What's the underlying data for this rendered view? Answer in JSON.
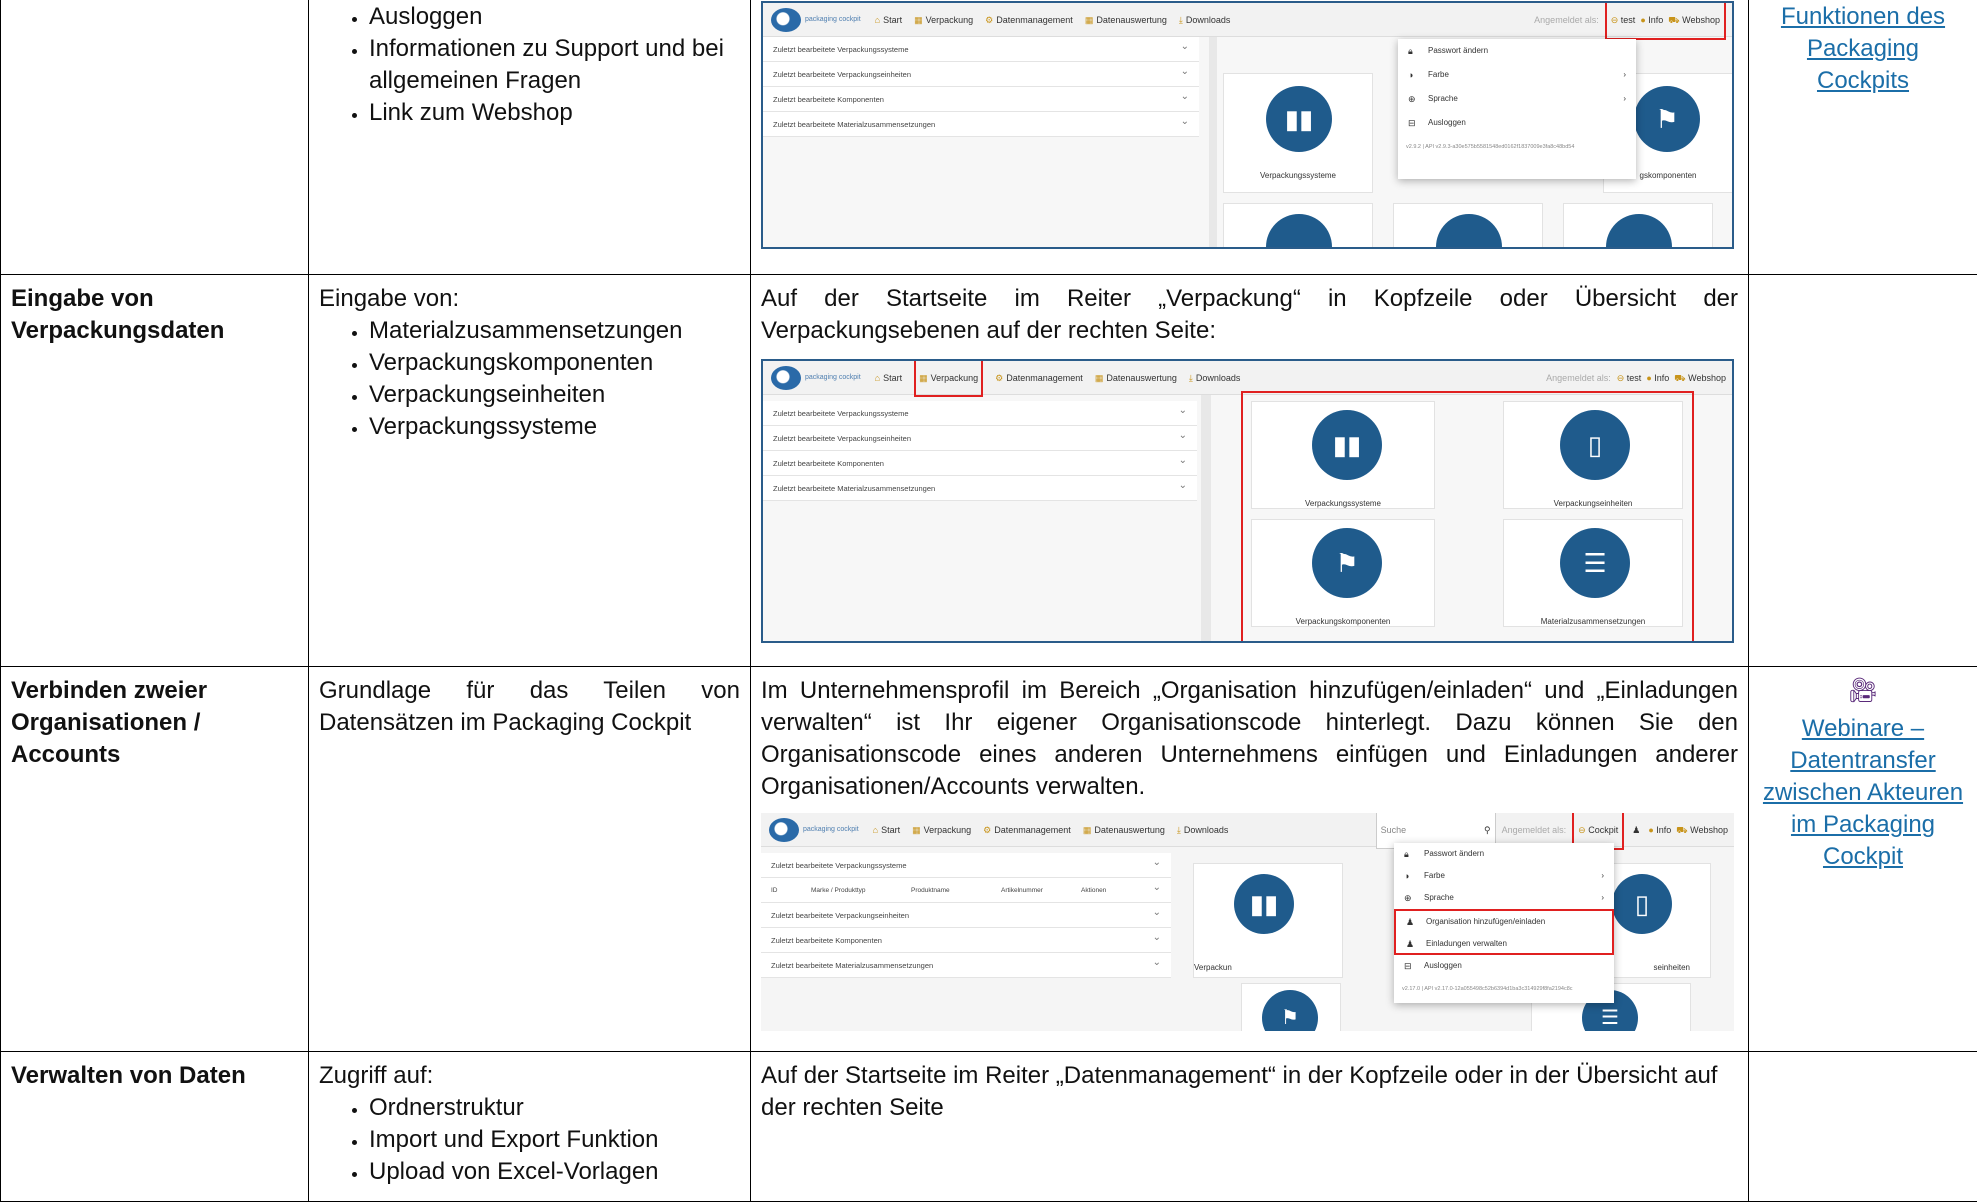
{
  "row1": {
    "bullets": [
      "Ausloggen",
      "Informationen zu Support und bei allgemeinen Fragen",
      "Link zum Webshop"
    ],
    "link": "Funktionen des Packaging Cockpits"
  },
  "row2": {
    "title": "Eingabe von Verpackungsdaten",
    "intro": "Eingabe von:",
    "bullets": [
      "Materialzusammensetzungen",
      "Verpackungskomponenten",
      "Verpackungseinheiten",
      "Verpackungssysteme"
    ],
    "description": "Auf der Startseite im Reiter „Verpackung“ in Kopfzeile oder Übersicht der Verpackungsebenen auf der rechten Seite:"
  },
  "row3": {
    "title": "Verbinden zweier Organisationen / Accounts",
    "desc": "Grundlage für das Teilen von Datensätzen im Packaging Cockpit",
    "description": "Im Unternehmensprofil im Bereich „Organisation hinzufügen/einladen“ und „Einladungen verwalten“ ist Ihr eigener Organisationscode hinterlegt. Dazu können Sie den Organisationscode eines anderen Unternehmens einfügen und Einladungen anderer Organisationen/Accounts verwalten.",
    "link": "Webinare – Datentransfer zwischen Akteuren im Packaging Cockpit"
  },
  "row4": {
    "title": "Verwalten von Daten",
    "intro": "Zugriff auf:",
    "bullets": [
      "Ordnerstruktur",
      "Import und Export Funktion",
      "Upload von Excel-Vorlagen"
    ],
    "description": "Auf der Startseite im Reiter „Datenmanagement“ in der Kopfzeile oder in der Übersicht auf der rechten Seite"
  },
  "shot": {
    "logo": "packaging cockpit",
    "nav": [
      "Start",
      "Verpackung",
      "Datenmanagement",
      "Datenauswertung",
      "Downloads"
    ],
    "logged_in": "Angemeldet als:",
    "user": "test",
    "info": "Info",
    "webshop": "Webshop",
    "cockpit": "Cockpit",
    "search": "Suche",
    "recent": [
      "Zuletzt bearbeitete Verpackungssysteme",
      "Zuletzt bearbeitete Verpackungseinheiten",
      "Zuletzt bearbeitete Komponenten",
      "Zuletzt bearbeitete Materialzusammensetzungen"
    ],
    "tiles": [
      "Verpackungssysteme",
      "Verpackungseinheiten",
      "Verpackungskomponenten",
      "Materialzusammensetzungen"
    ],
    "tile_partial": "gskomponenten",
    "tile_partial2": "Verpackun",
    "tile_partial3": "seinheiten",
    "table_cols": [
      "ID",
      "Marke / Produkttyp",
      "Produktname",
      "Artikelnummer",
      "Aktionen"
    ],
    "menu1": [
      "Passwort ändern",
      "Farbe",
      "Sprache",
      "Ausloggen"
    ],
    "menu2": [
      "Passwort ändern",
      "Farbe",
      "Sprache",
      "Organisation hinzufügen/einladen",
      "Einladungen verwalten",
      "Ausloggen"
    ],
    "version1": "v2.9.2 | API v2.9.3-a30e575b5581548ed0162f1837009e3fa8c48bd54",
    "version2": "v2.17.0 | API v2.17.0-12a055498c52b6394d1ba3c314929f8fa2194c8c"
  }
}
